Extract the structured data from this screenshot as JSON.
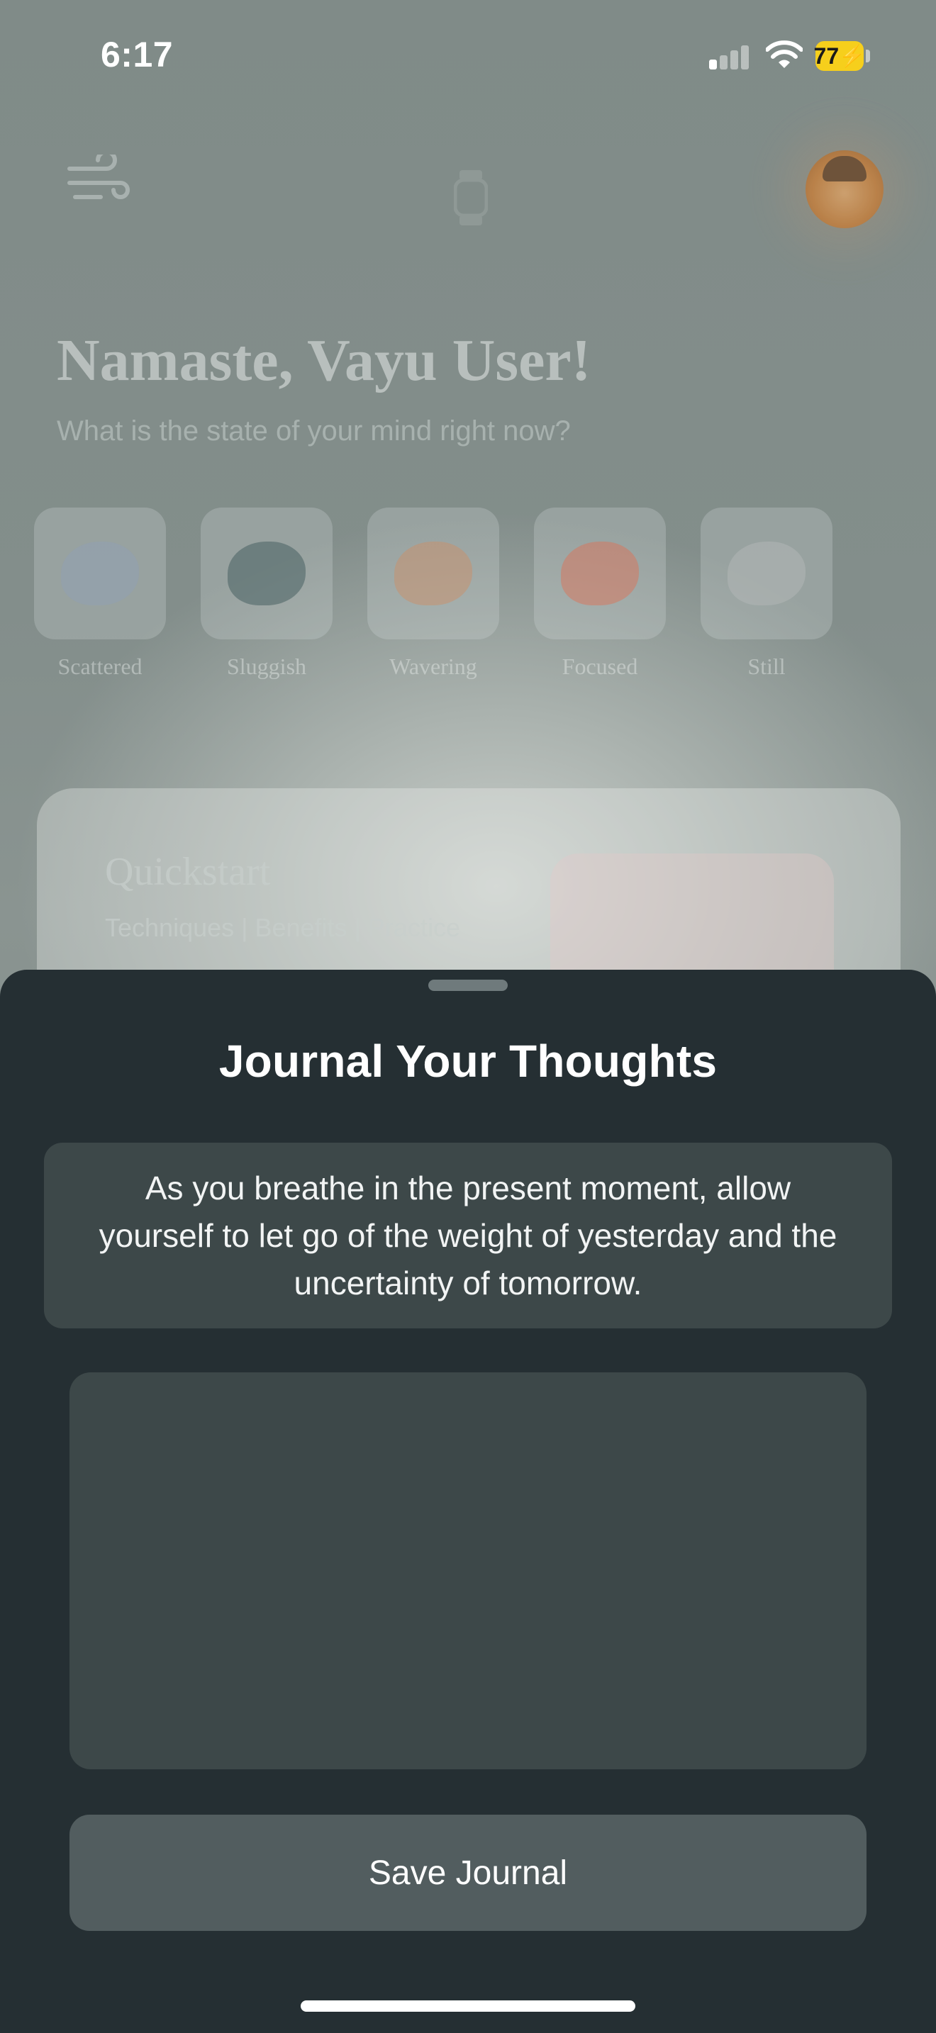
{
  "status_bar": {
    "time": "6:17",
    "battery": "77",
    "battery_color": "#f6cf1c"
  },
  "background": {
    "icons": [
      "wind-icon",
      "watch-icon",
      "avatar"
    ],
    "greeting": "Namaste, Vayu User!",
    "prompt": "What is the state of your mind right now?",
    "moods": [
      {
        "label": "Scattered",
        "color": "#8fa0b4"
      },
      {
        "label": "Sluggish",
        "color": "#3f5a5c"
      },
      {
        "label": "Wavering",
        "color": "#c9906a"
      },
      {
        "label": "Focused",
        "color": "#d9735a"
      },
      {
        "label": "Still",
        "color": "#b4b8b8"
      }
    ],
    "quickstart": {
      "title": "Quickstart",
      "subtitle": "Techniques | Benefits | Practice"
    }
  },
  "sheet": {
    "title": "Journal Your Thoughts",
    "quote": "As you breathe in the present moment, allow yourself to let go of the weight of yesterday and the uncertainty of tomorrow.",
    "input_value": "",
    "input_placeholder": "",
    "save_label": "Save Journal",
    "background_color": "#252f33"
  }
}
